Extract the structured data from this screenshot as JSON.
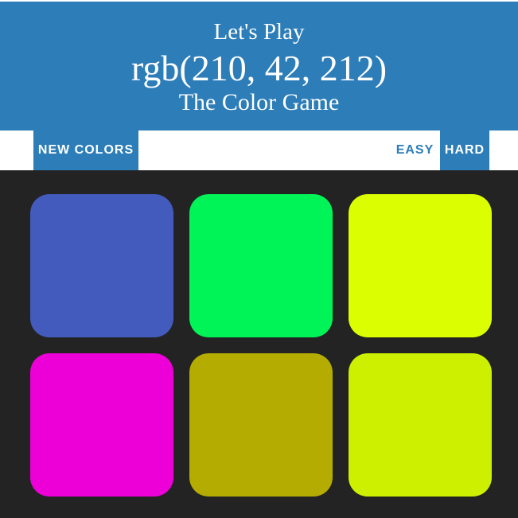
{
  "header": {
    "intro": "Let's Play",
    "target_rgb": "rgb(210, 42, 212)",
    "subtitle": "The Color Game"
  },
  "controls": {
    "new_colors_label": "NEW COLORS",
    "easy_label": "EASY",
    "hard_label": "HARD",
    "selected_mode": "HARD"
  },
  "squares": [
    {
      "color": "#435bbd"
    },
    {
      "color": "#00f457"
    },
    {
      "color": "#dbff00"
    },
    {
      "color": "#ed00d8"
    },
    {
      "color": "#b4ac00"
    },
    {
      "color": "#cdf000"
    }
  ],
  "colors": {
    "accent": "#2c7db8",
    "background": "#232323",
    "stripe": "#ffffff"
  }
}
